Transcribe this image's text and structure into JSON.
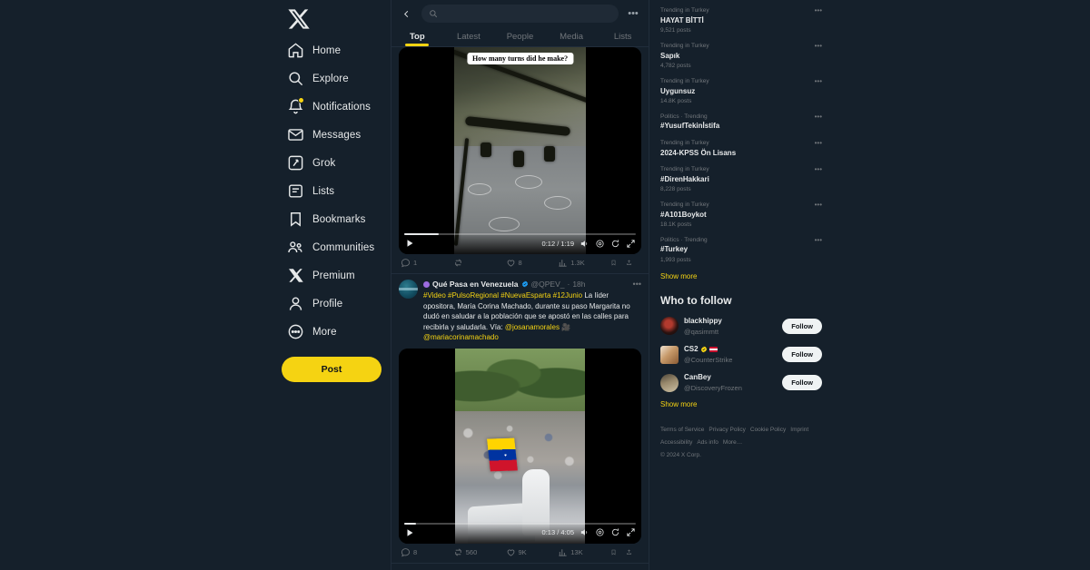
{
  "sidebar": {
    "logo_icon": "x-logo-icon",
    "items": [
      {
        "label": "Home",
        "icon": "home-icon"
      },
      {
        "label": "Explore",
        "icon": "search-icon"
      },
      {
        "label": "Notifications",
        "icon": "bell-icon",
        "badge": true
      },
      {
        "label": "Messages",
        "icon": "envelope-icon"
      },
      {
        "label": "Grok",
        "icon": "grok-icon"
      },
      {
        "label": "Lists",
        "icon": "list-icon"
      },
      {
        "label": "Bookmarks",
        "icon": "bookmark-icon"
      },
      {
        "label": "Communities",
        "icon": "communities-icon"
      },
      {
        "label": "Premium",
        "icon": "x-premium-icon"
      },
      {
        "label": "Profile",
        "icon": "person-icon"
      },
      {
        "label": "More",
        "icon": "more-circle-icon"
      }
    ],
    "post_button": "Post",
    "accent_color": "#f5d312"
  },
  "topbar": {
    "back_icon": "back-arrow-icon",
    "search_placeholder": "",
    "search_value": "",
    "overflow_icon": "more-horizontal-icon"
  },
  "tabs": [
    {
      "label": "Top",
      "active": true
    },
    {
      "label": "Latest",
      "active": false
    },
    {
      "label": "People",
      "active": false
    },
    {
      "label": "Media",
      "active": false
    },
    {
      "label": "Lists",
      "active": false
    }
  ],
  "posts": [
    {
      "caption_overlay": "How many turns did he make?",
      "video": {
        "current_time": "0:12",
        "duration": "1:19",
        "time_display": "0:12 / 1:19",
        "progress_percent": 15,
        "play_icon": "play-icon",
        "mute_icon": "volume-icon",
        "settings_icon": "gear-icon",
        "replay_icon": "replay-icon",
        "expand_icon": "expand-icon"
      },
      "metrics": {
        "replies": "1",
        "reposts": "",
        "likes": "8",
        "views": "1.3K"
      }
    },
    {
      "author": {
        "display_name": "Qué Pasa en Venezuela",
        "verified": true,
        "handle": "@QPEV_",
        "time": "18h",
        "separator": "·"
      },
      "text_parts": [
        {
          "text": "#Video #PulsoRegional #NuevaEsparta #12Junio",
          "highlight": true
        },
        {
          "text": " La líder opositora, María Corina Machado, durante su paso Margarita no dudó en saludar a la población que se apostó en las calles para recibirla y saludarla. Vía: ",
          "highlight": false
        },
        {
          "text": "@josanamorales",
          "highlight": true
        },
        {
          "text": " 🎥 ",
          "highlight": false
        },
        {
          "text": "@mariacorinamachado",
          "highlight": true
        }
      ],
      "video": {
        "current_time": "0:13",
        "duration": "4:05",
        "time_display": "0:13 / 4:05",
        "progress_percent": 5,
        "play_icon": "play-icon",
        "mute_icon": "volume-icon",
        "settings_icon": "gear-icon",
        "replay_icon": "replay-icon",
        "expand_icon": "expand-icon"
      },
      "metrics": {
        "replies": "8",
        "reposts": "560",
        "likes": "9K",
        "views": "13K"
      }
    }
  ],
  "trends": [
    {
      "category": "Trending in Turkey",
      "name": "HAYAT BİTTİ",
      "count": "9,521 posts"
    },
    {
      "category": "Trending in Turkey",
      "name": "Sapık",
      "count": "4,782 posts"
    },
    {
      "category": "Trending in Turkey",
      "name": "Uygunsuz",
      "count": "14.8K posts"
    },
    {
      "category": "Politics · Trending",
      "name": "#YusufTekinİstifa",
      "count": ""
    },
    {
      "category": "Trending in Turkey",
      "name": "2024-KPSS Ön Lisans",
      "count": ""
    },
    {
      "category": "Trending in Turkey",
      "name": "#DirenHakkari",
      "count": "8,228 posts"
    },
    {
      "category": "Trending in Turkey",
      "name": "#A101Boykot",
      "count": "18.1K posts"
    },
    {
      "category": "Politics · Trending",
      "name": "#Turkey",
      "count": "1,993 posts"
    }
  ],
  "trends_show_more": "Show more",
  "who_to_follow": {
    "title": "Who to follow",
    "accounts": [
      {
        "name": "blackhippy",
        "handle": "@qasimmtt",
        "verified": false,
        "flag": false,
        "follow_label": "Follow"
      },
      {
        "name": "CS2",
        "handle": "@CounterStrike",
        "verified": true,
        "flag": true,
        "follow_label": "Follow"
      },
      {
        "name": "CanBey",
        "handle": "@DiscoveryFrozen",
        "verified": false,
        "flag": false,
        "follow_label": "Follow"
      }
    ],
    "show_more": "Show more"
  },
  "footer": {
    "links": [
      "Terms of Service",
      "Privacy Policy",
      "Cookie Policy",
      "Imprint",
      "Accessibility",
      "Ads info",
      "More…"
    ],
    "copyright": "© 2024 X Corp."
  }
}
